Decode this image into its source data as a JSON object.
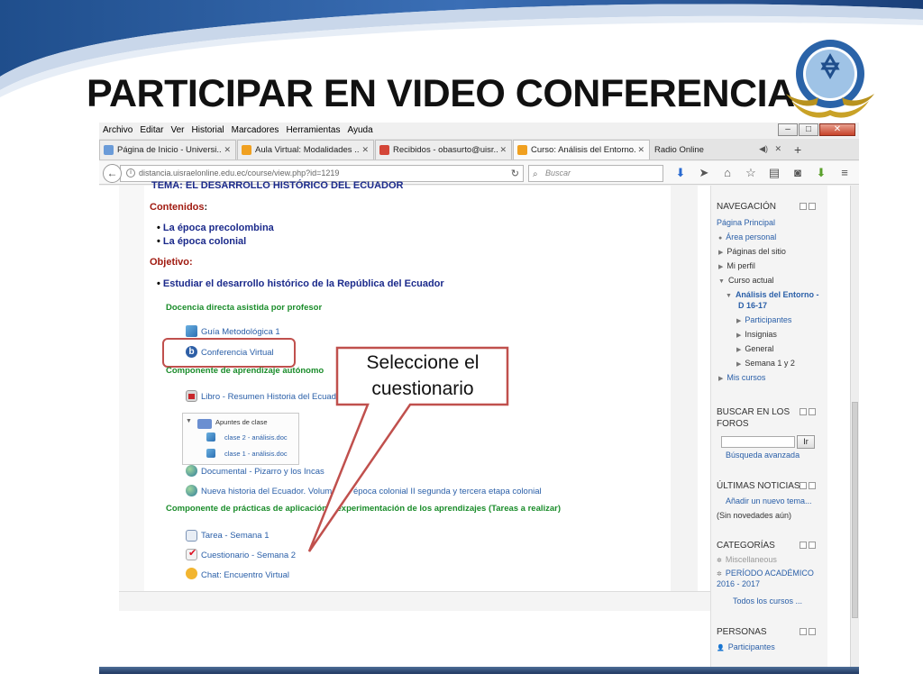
{
  "slide": {
    "title": "PARTICIPAR EN VIDEO CONFERENCIA",
    "callout": "Seleccione el cuestionario"
  },
  "browser": {
    "menu": [
      "Archivo",
      "Editar",
      "Ver",
      "Historial",
      "Marcadores",
      "Herramientas",
      "Ayuda"
    ],
    "tabs": [
      {
        "label": "Página de Inicio - Universi...",
        "icon_color": "#6a9bd8"
      },
      {
        "label": "Aula Virtual: Modalidades ...",
        "icon_color": "#f0a020"
      },
      {
        "label": "Recibidos - obasurto@uisr...",
        "icon_color": "#d44638"
      },
      {
        "label": "Curso: Análisis del Entorno...",
        "icon_color": "#f0a020"
      }
    ],
    "radio_tab": "Radio Online",
    "url": "distancia.uisraelonline.edu.ec/course/view.php?id=1219",
    "search_placeholder": "Buscar"
  },
  "course": {
    "tema": "TEMA: EL DESARROLLO HISTÓRICO DEL ECUADOR",
    "contenidos_label": "Contenidos",
    "contenidos": [
      "La época precolombina",
      "La época colonial"
    ],
    "objetivo_label": "Objetivo:",
    "objetivo": "Estudiar el desarrollo histórico de la República del Ecuador",
    "sections": {
      "docencia": "Docencia directa asistida por profesor",
      "autonomo": "Componente  de aprendizaje autónomo",
      "practicas": "Componente de prácticas de aplicación y experimentación de los aprendizajes (Tareas a realizar)"
    },
    "resources": {
      "guia": "Guía Metodológica 1",
      "conferencia": "Conferencia Virtual",
      "libro": "Libro - Resumen Historia del Ecuador",
      "apuntes": "Apuntes de clase",
      "clase2": "clase 2 - análisis.doc",
      "clase1": "clase 1 - análisis.doc",
      "documental": "Documental - Pizarro y los Incas",
      "nueva_historia": "Nueva historia del Ecuador. Volumen 4: época colonial II segunda y tercera etapa colonial",
      "tarea": "Tarea - Semana 1",
      "cuestionario": "Cuestionario - Semana 2",
      "chat": "Chat: Encuentro Virtual"
    }
  },
  "sidebar": {
    "navegacion": {
      "title": "NAVEGACIÓN",
      "pagina_principal": "Página Principal",
      "area_personal": "Área personal",
      "paginas_sitio": "Páginas del sitio",
      "mi_perfil": "Mi perfil",
      "curso_actual": "Curso actual",
      "curso_nombre_1": "Análisis del Entorno -",
      "curso_nombre_2": "D 16-17",
      "participantes": "Participantes",
      "insignias": "Insignias",
      "general": "General",
      "semana": "Semana 1 y 2",
      "mis_cursos": "Mis cursos"
    },
    "buscar": {
      "title_1": "BUSCAR EN LOS",
      "title_2": "FOROS",
      "button": "Ir",
      "avanzada": "Búsqueda avanzada"
    },
    "noticias": {
      "title": "ÚLTIMAS NOTICIAS",
      "add": "Añadir un nuevo tema...",
      "none": "(Sin novedades aún)"
    },
    "categorias": {
      "title": "CATEGORÍAS",
      "misc": "Miscellaneous",
      "periodo_1": "PERÍODO ACADÉMICO",
      "periodo_2": "2016 - 2017",
      "todos": "Todos los cursos ..."
    },
    "personas": {
      "title": "PERSONAS",
      "participantes": "Participantes"
    }
  }
}
